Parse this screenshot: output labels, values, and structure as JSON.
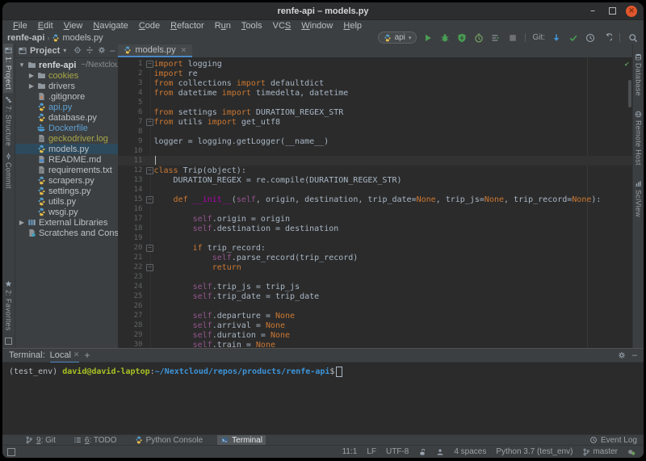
{
  "window": {
    "title": "renfe-api – models.py"
  },
  "menu": {
    "items": [
      {
        "label": "File",
        "u": 0
      },
      {
        "label": "Edit",
        "u": 0
      },
      {
        "label": "View",
        "u": 0
      },
      {
        "label": "Navigate",
        "u": 0
      },
      {
        "label": "Code",
        "u": 0
      },
      {
        "label": "Refactor",
        "u": 0
      },
      {
        "label": "Run",
        "u": 1
      },
      {
        "label": "Tools",
        "u": 0
      },
      {
        "label": "VCS",
        "u": 2
      },
      {
        "label": "Window",
        "u": 0
      },
      {
        "label": "Help",
        "u": 0
      }
    ]
  },
  "navbar": {
    "breadcrumbs": [
      {
        "label": "renfe-api",
        "icon": null
      },
      {
        "label": "models.py",
        "icon": "python"
      }
    ],
    "run_config": {
      "label": "api",
      "icon": "python"
    },
    "buttons": [
      {
        "name": "run-button",
        "icon": "play"
      },
      {
        "name": "debug-button",
        "icon": "bug"
      },
      {
        "name": "coverage-button",
        "icon": "coverage"
      },
      {
        "name": "profiler-button",
        "icon": "profiler"
      },
      {
        "name": "concurrency-button",
        "icon": "concurrency"
      },
      {
        "name": "stop-button",
        "icon": "stop"
      }
    ],
    "git_label": "Git:",
    "vcs_buttons": [
      {
        "name": "vcs-update-button",
        "icon": "update"
      },
      {
        "name": "vcs-commit-button",
        "icon": "check"
      },
      {
        "name": "vcs-history-button",
        "icon": "history"
      },
      {
        "name": "vcs-rollback-button",
        "icon": "rollback"
      }
    ],
    "search_button": {
      "name": "search-everywhere-button",
      "icon": "search"
    }
  },
  "left_stripe": {
    "top": [
      {
        "label": "1: Project",
        "icon": "winproj",
        "active": true
      },
      {
        "label": "7: Structure",
        "icon": "structure",
        "active": false
      },
      {
        "label": "Commit",
        "icon": "commit",
        "active": false
      }
    ],
    "bottom": [
      {
        "label": "2: Favorites",
        "icon": "star",
        "active": false
      }
    ]
  },
  "right_stripe": [
    {
      "label": "Database",
      "icon": "db"
    },
    {
      "label": "Remote Host",
      "icon": "remote"
    },
    {
      "label": "SciView",
      "icon": "sci"
    }
  ],
  "project_panel": {
    "header": "Project",
    "tree": [
      {
        "icon": "folder",
        "label": "renfe-api",
        "suffix": "~/Nextcloud/rep",
        "arrow": "down",
        "indent": 0,
        "bold": true
      },
      {
        "icon": "folder",
        "label": "cookies",
        "color": "ignored",
        "arrow": "right",
        "indent": 1
      },
      {
        "icon": "folder",
        "label": "drivers",
        "arrow": "right",
        "indent": 1
      },
      {
        "icon": "gitignore",
        "label": ".gitignore",
        "indent": 1
      },
      {
        "icon": "python",
        "label": "api.py",
        "color": "modified",
        "indent": 1
      },
      {
        "icon": "python",
        "label": "database.py",
        "indent": 1
      },
      {
        "icon": "docker",
        "label": "Dockerfile",
        "color": "modified",
        "indent": 1
      },
      {
        "icon": "filetext",
        "label": "geckodriver.log",
        "color": "ignored",
        "indent": 1
      },
      {
        "icon": "python",
        "label": "models.py",
        "selected": true,
        "indent": 1
      },
      {
        "icon": "md",
        "label": "README.md",
        "indent": 1
      },
      {
        "icon": "filetext",
        "label": "requirements.txt",
        "indent": 1
      },
      {
        "icon": "python",
        "label": "scrapers.py",
        "indent": 1
      },
      {
        "icon": "python",
        "label": "settings.py",
        "indent": 1
      },
      {
        "icon": "python",
        "label": "utils.py",
        "indent": 1
      },
      {
        "icon": "python",
        "label": "wsgi.py",
        "indent": 1
      },
      {
        "icon": "library",
        "label": "External Libraries",
        "arrow": "right",
        "indent": 0
      },
      {
        "icon": "scratches",
        "label": "Scratches and Consoles",
        "indent": 0
      }
    ]
  },
  "editor": {
    "tab": {
      "label": "models.py",
      "icon": "python"
    },
    "folded_lines": [
      1,
      7,
      12,
      15,
      20,
      22
    ],
    "caret_line": 11,
    "lines": [
      {
        "n": 1,
        "segs": [
          [
            "k",
            "import"
          ],
          [
            "p",
            " logging"
          ]
        ]
      },
      {
        "n": 2,
        "segs": [
          [
            "k",
            "import"
          ],
          [
            "p",
            " re"
          ]
        ]
      },
      {
        "n": 3,
        "segs": [
          [
            "k",
            "from"
          ],
          [
            "p",
            " collections "
          ],
          [
            "k",
            "import"
          ],
          [
            "p",
            " defaultdict"
          ]
        ]
      },
      {
        "n": 4,
        "segs": [
          [
            "k",
            "from"
          ],
          [
            "p",
            " datetime "
          ],
          [
            "k",
            "import"
          ],
          [
            "p",
            " timedelta, datetime"
          ]
        ]
      },
      {
        "n": 5,
        "segs": []
      },
      {
        "n": 6,
        "segs": [
          [
            "k",
            "from"
          ],
          [
            "p",
            " settings "
          ],
          [
            "k",
            "import"
          ],
          [
            "p",
            " DURATION_REGEX_STR"
          ]
        ]
      },
      {
        "n": 7,
        "segs": [
          [
            "k",
            "from"
          ],
          [
            "p",
            " utils "
          ],
          [
            "k",
            "import"
          ],
          [
            "p",
            " get_utf8"
          ]
        ]
      },
      {
        "n": 8,
        "segs": []
      },
      {
        "n": 9,
        "segs": [
          [
            "p",
            "logger = logging.getLogger(__name__)"
          ]
        ]
      },
      {
        "n": 10,
        "segs": []
      },
      {
        "n": 11,
        "segs": []
      },
      {
        "n": 12,
        "segs": [
          [
            "k",
            "class"
          ],
          [
            "p",
            " Trip(object):"
          ]
        ]
      },
      {
        "n": 13,
        "segs": [
          [
            "p",
            "    DURATION_REGEX = re.compile(DURATION_REGEX_STR)"
          ]
        ]
      },
      {
        "n": 14,
        "segs": []
      },
      {
        "n": 15,
        "segs": [
          [
            "k",
            "    def "
          ],
          [
            "m",
            "__init__"
          ],
          [
            "p",
            "("
          ],
          [
            "s",
            "self"
          ],
          [
            "p",
            ", origin, destination, trip_date="
          ],
          [
            "k",
            "None"
          ],
          [
            "p",
            ", trip_js="
          ],
          [
            "k",
            "None"
          ],
          [
            "p",
            ", trip_record="
          ],
          [
            "k",
            "None"
          ],
          [
            "p",
            "):"
          ]
        ]
      },
      {
        "n": 16,
        "segs": []
      },
      {
        "n": 17,
        "segs": [
          [
            "p",
            "        "
          ],
          [
            "s",
            "self"
          ],
          [
            "p",
            ".origin = origin"
          ]
        ]
      },
      {
        "n": 18,
        "segs": [
          [
            "p",
            "        "
          ],
          [
            "s",
            "self"
          ],
          [
            "p",
            ".destination = destination"
          ]
        ]
      },
      {
        "n": 19,
        "segs": []
      },
      {
        "n": 20,
        "segs": [
          [
            "k",
            "        if"
          ],
          [
            "p",
            " trip_record:"
          ]
        ]
      },
      {
        "n": 21,
        "segs": [
          [
            "p",
            "            "
          ],
          [
            "s",
            "self"
          ],
          [
            "p",
            ".parse_record(trip_record)"
          ]
        ]
      },
      {
        "n": 22,
        "segs": [
          [
            "k",
            "            return"
          ]
        ]
      },
      {
        "n": 23,
        "segs": []
      },
      {
        "n": 24,
        "segs": [
          [
            "p",
            "        "
          ],
          [
            "s",
            "self"
          ],
          [
            "p",
            ".trip_js = trip_js"
          ]
        ]
      },
      {
        "n": 25,
        "segs": [
          [
            "p",
            "        "
          ],
          [
            "s",
            "self"
          ],
          [
            "p",
            ".trip_date = trip_date"
          ]
        ]
      },
      {
        "n": 26,
        "segs": []
      },
      {
        "n": 27,
        "segs": [
          [
            "p",
            "        "
          ],
          [
            "s",
            "self"
          ],
          [
            "p",
            ".departure = "
          ],
          [
            "k",
            "None"
          ]
        ]
      },
      {
        "n": 28,
        "segs": [
          [
            "p",
            "        "
          ],
          [
            "s",
            "self"
          ],
          [
            "p",
            ".arrival = "
          ],
          [
            "k",
            "None"
          ]
        ]
      },
      {
        "n": 29,
        "segs": [
          [
            "p",
            "        "
          ],
          [
            "s",
            "self"
          ],
          [
            "p",
            ".duration = "
          ],
          [
            "k",
            "None"
          ]
        ]
      },
      {
        "n": 30,
        "segs": [
          [
            "p",
            "        "
          ],
          [
            "s",
            "self"
          ],
          [
            "p",
            ".train = "
          ],
          [
            "k",
            "None"
          ]
        ]
      }
    ]
  },
  "terminal": {
    "label": "Terminal:",
    "tab": "Local",
    "new_tab": "+",
    "prompt": [
      [
        "plain",
        "(test_env) "
      ],
      [
        "user",
        "david@david-laptop"
      ],
      [
        "plain",
        ":"
      ],
      [
        "path",
        "~/Nextcloud/repos/products/renfe-api"
      ],
      [
        "plain",
        "$"
      ]
    ]
  },
  "bottom_bar": {
    "left": [
      {
        "label": "9: Git",
        "u": 0,
        "icon": "branch",
        "active": false
      },
      {
        "label": "6: TODO",
        "u": 0,
        "icon": "todo",
        "active": false
      },
      {
        "label": "Python Console",
        "icon": "python",
        "active": false
      },
      {
        "label": "Terminal",
        "icon": "terminal",
        "active": true
      }
    ],
    "event_log": "Event Log"
  },
  "status_bar": {
    "items": [
      {
        "t": "text",
        "v": "11:1",
        "name": "caret-position"
      },
      {
        "t": "text",
        "v": "LF",
        "name": "line-separator"
      },
      {
        "t": "text",
        "v": "UTF-8",
        "name": "file-encoding"
      },
      {
        "t": "icon",
        "icon": "lock",
        "name": "readonly-toggle"
      },
      {
        "t": "icon",
        "icon": "hector",
        "name": "inspections-widget"
      },
      {
        "t": "text",
        "v": "4 spaces",
        "name": "indent-style"
      },
      {
        "t": "text",
        "v": "Python 3.7 (test_env)",
        "name": "python-interpreter"
      },
      {
        "t": "branch",
        "v": "master",
        "name": "git-branch-widget"
      },
      {
        "t": "icon",
        "icon": "notify",
        "name": "notifications-widget"
      }
    ]
  },
  "colors": {
    "accent_blue": "#4a88c7",
    "run_green": "#499c54",
    "close_orange": "#e0562c",
    "keyword": "#cc7832",
    "self": "#94558d",
    "magic": "#b200b2",
    "code": "#a9b7c6",
    "ignored": "#a7a648",
    "modified": "#5da0d4",
    "terminal_user": "#a8c023",
    "terminal_path": "#3d94d9"
  }
}
